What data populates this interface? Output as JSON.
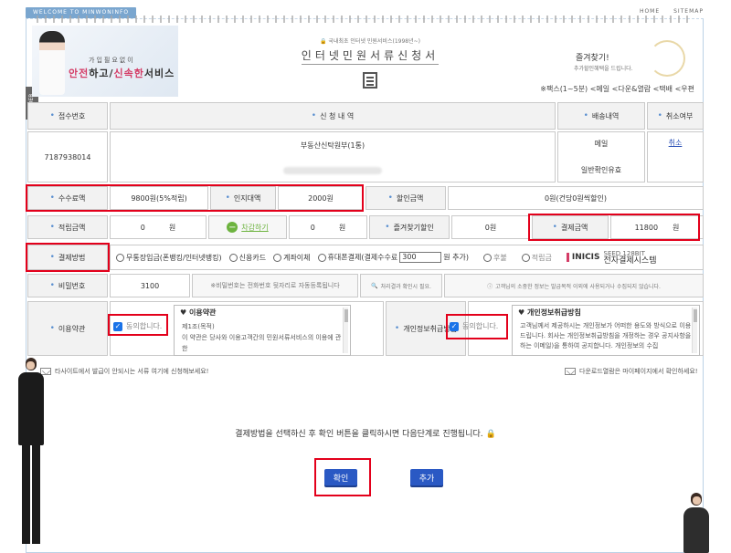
{
  "top": {
    "welcome": "WELCOME TO MINWONINFO",
    "links": [
      "HOME",
      "SITEMAP"
    ],
    "side_tab": "ORDER"
  },
  "header": {
    "brand_sub": "가입필요없이",
    "brand_main_a": "안전",
    "brand_main_b": "하고/",
    "brand_main_c": "신속한",
    "brand_main_d": "서비스",
    "notice": "국내최초 인터넷 민원서비스(1998년~)",
    "title": "인터넷민원서류신청서",
    "promo_title": "즐겨찾기!",
    "promo_sub": "추가할인혜택을 드립니다.",
    "shipping": "※팩스(1~5분) <메일 <다운&열람 <택배 <우편"
  },
  "columns": {
    "receipt_no": "접수번호",
    "details": "신 청 내 역",
    "delivery": "배송내역",
    "cancel": "취소여부"
  },
  "order": {
    "receipt_no": "7187938014",
    "item": "부동산신탁원부(1통)",
    "delivery_method": "메일",
    "delivery_type": "일반확인유효",
    "cancel_label": "취소"
  },
  "fees": {
    "fee_label": "수수료액",
    "fee_value": "9800원(5%적립)",
    "stamp_label": "인지대액",
    "stamp_value": "2000원",
    "discount_label": "할인금액",
    "discount_value": "0원(건당0원씩할인)",
    "points_label": "적립금액",
    "points_value": "0",
    "points_unit": "원",
    "deduct_button": "차감하기",
    "deduct_value": "0",
    "deduct_unit": "원",
    "fav_label": "즐겨찾기할인",
    "fav_value": "0원",
    "total_label": "결제금액",
    "total_value": "11800",
    "total_unit": "원"
  },
  "payment": {
    "label": "결제방법",
    "options": [
      "무통장입금(폰뱅킹/인터넷뱅킹)",
      "신용카드",
      "계좌이체"
    ],
    "mobile_prefix": "휴대폰결제(결제수수료",
    "mobile_fee": "300",
    "mobile_suffix": "원 추가)",
    "deferred": "후불",
    "points": "적립금",
    "pg_brand": "INICIS",
    "pg_tag": "SEED 128BIT",
    "pg_name": "전자결제시스템"
  },
  "password": {
    "label": "비밀번호",
    "value": "3100",
    "hint": "※비밀번호는 전화번호 뒷자리로 자동등록됩니다",
    "check_note": "처리결과 확인시 필요.",
    "privacy_note": "고객님의 소중한 정보는 발급목적 이외에 사용되거나 수집되지 않습니다."
  },
  "terms": {
    "label": "이용약관",
    "agree": "동의합니다.",
    "box_title": "이용약관",
    "line1": "제1조(목적)",
    "line2": "이 약관은 당사와 이용고객간의 민원서류서비스의 이용에 관한"
  },
  "privacy": {
    "label": "개인정보취급방침",
    "agree": "동의합니다.",
    "box_title": "개인정보취급방침",
    "line1": "고객님께서 제공하시는 개인정보가 어떠한 용도와 방식으로 이용",
    "line2": "드립니다. 회사는 개인정보취급방침을 개정하는 경우 공지사항을",
    "line3": "하는 이메일)을 통하여 공지합니다. 개인정보의 수집"
  },
  "footer": {
    "left_note": "타사이트에서 발급이 안되시는 서류 여기에 신청해보세요!",
    "right_note": "다운로드열람은 마이페이지에서 확인하세요!",
    "instruction": "결제방법을 선택하신 후 확인 버튼을 클릭하시면 다음단계로 진행됩니다.",
    "confirm": "확인",
    "add": "추가"
  }
}
